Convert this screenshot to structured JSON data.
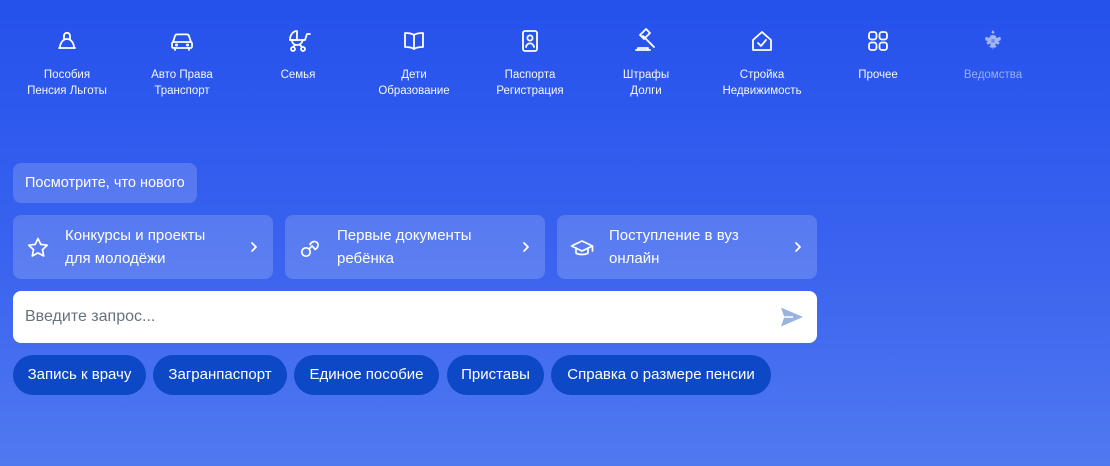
{
  "categories": [
    {
      "line1": "Пособия",
      "line2": "Пенсия Льготы",
      "icon": "bell-icon"
    },
    {
      "line1": "Авто Права",
      "line2": "Транспорт",
      "icon": "car-icon"
    },
    {
      "line1": "Семья",
      "line2": "",
      "icon": "stroller-icon"
    },
    {
      "line1": "Дети",
      "line2": "Образование",
      "icon": "open-book-icon"
    },
    {
      "line1": "Паспорта",
      "line2": "Регистрация",
      "icon": "passport-icon"
    },
    {
      "line1": "Штрафы",
      "line2": "Долги",
      "icon": "gavel-icon"
    },
    {
      "line1": "Стройка",
      "line2": "Недвижимость",
      "icon": "house-check-icon"
    },
    {
      "line1": "Прочее",
      "line2": "",
      "icon": "grid-icon"
    },
    {
      "line1": "Ведомства",
      "line2": "",
      "icon": "coat-of-arms-icon"
    }
  ],
  "news_button": "Посмотрите, что нового",
  "promos": [
    {
      "line1": "Конкурсы и проекты",
      "line2": "для молодёжи",
      "icon": "star-icon"
    },
    {
      "line1": "Первые документы",
      "line2": "ребёнка",
      "icon": "pacifier-icon"
    },
    {
      "line1": "Поступление в вуз",
      "line2": "онлайн",
      "icon": "graduation-cap-icon"
    }
  ],
  "search": {
    "placeholder": "Введите запрос...",
    "value": ""
  },
  "chips": [
    "Запись к врачу",
    "Загранпаспорт",
    "Единое пособие",
    "Приставы",
    "Справка о размере пенсии"
  ],
  "colors": {
    "background_top": "#2551ec",
    "background_bottom": "#5079f0",
    "chip": "#0d48c7",
    "card": "rgba(255,255,255,0.17)",
    "send_icon": "#9bb3e0"
  }
}
